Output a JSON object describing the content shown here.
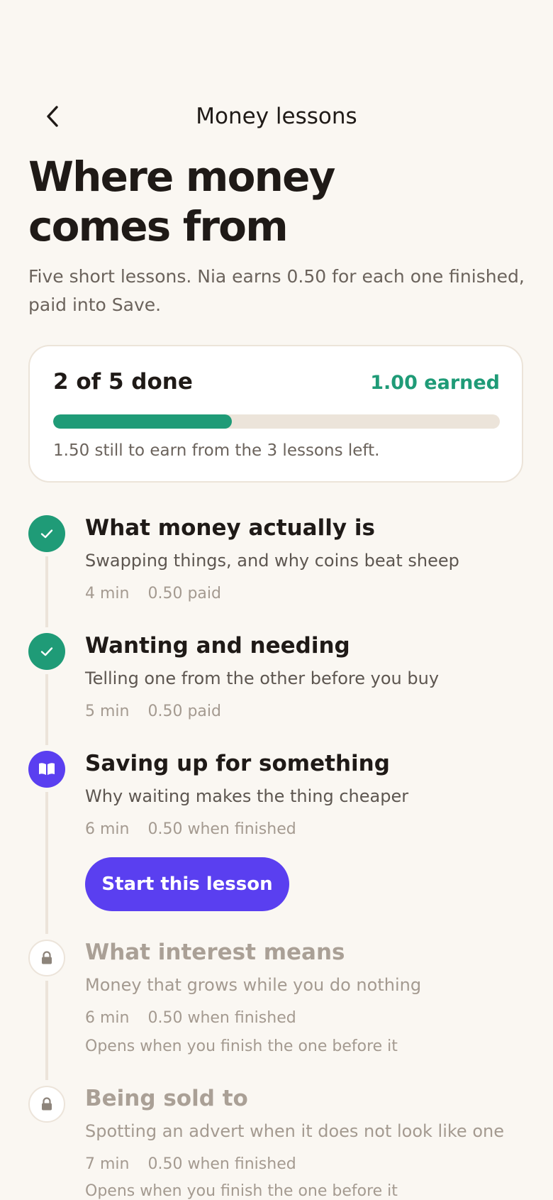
{
  "nav": {
    "title": "Money lessons"
  },
  "page": {
    "title_line1": "Where money",
    "title_line2": "comes from",
    "intro": "Five short lessons. Nia earns 0.50 for each one finished, paid into Save."
  },
  "progress": {
    "done_label": "2 of 5 done",
    "earned_label": "1.00 earned",
    "fraction": 0.4,
    "remaining_label": "1.50 still to earn from the 3 lessons left."
  },
  "lessons": [
    {
      "title": "What money actually is",
      "subtitle": "Swapping things, and why coins beat sheep",
      "duration": "4 min",
      "reward": "0.50 paid",
      "status": "done",
      "icon": "check-icon"
    },
    {
      "title": "Wanting and needing",
      "subtitle": "Telling one from the other before you buy",
      "duration": "5 min",
      "reward": "0.50 paid",
      "status": "done",
      "icon": "check-icon"
    },
    {
      "title": "Saving up for something",
      "subtitle": "Why waiting makes the thing cheaper",
      "duration": "6 min",
      "reward": "0.50 when finished",
      "status": "current",
      "icon": "book-icon",
      "action_label": "Start this lesson"
    },
    {
      "title": "What interest means",
      "subtitle": "Money that grows while you do nothing",
      "duration": "6 min",
      "reward": "0.50 when finished",
      "status": "locked",
      "icon": "lock-icon",
      "note": "Opens when you finish the one before it"
    },
    {
      "title": "Being sold to",
      "subtitle": "Spotting an advert when it does not look like one",
      "duration": "7 min",
      "reward": "0.50 when finished",
      "status": "locked",
      "icon": "lock-icon",
      "note": "Opens when you finish the one before it"
    }
  ],
  "colors": {
    "background": "#faf7f2",
    "done": "#1f9b77",
    "current": "#5a3ff0",
    "locked_text": "#aaa096"
  }
}
